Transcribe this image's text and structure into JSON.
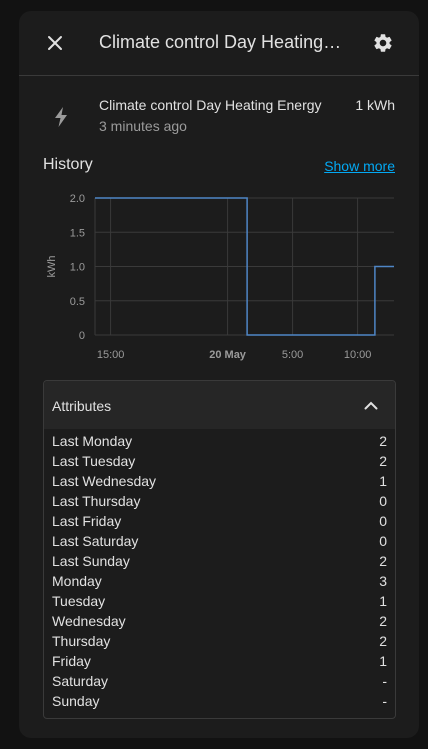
{
  "dialog": {
    "title": "Climate control Day Heating Energy",
    "close_icon": "close-icon",
    "settings_icon": "gear-icon"
  },
  "entity": {
    "icon": "flash-icon",
    "name": "Climate control Day Heating Energy",
    "time": "3 minutes ago",
    "state": "1 kWh"
  },
  "history": {
    "title": "History",
    "show_more": "Show more"
  },
  "chart_data": {
    "type": "line",
    "step": true,
    "ylabel": "kWh",
    "ylim": [
      0,
      2.0
    ],
    "yticks": [
      "2.0",
      "1.5",
      "1.0",
      "0.5",
      "0"
    ],
    "xticks": [
      "15:00",
      "20 May",
      "5:00",
      "10:00"
    ],
    "x_range_hours": [
      13.8,
      12.8
    ],
    "series": [
      {
        "color": "#4f86c6",
        "points": [
          {
            "x": "19 May 13:48",
            "y": 2
          },
          {
            "x": "20 May 01:30",
            "y": 2
          },
          {
            "x": "20 May 01:30",
            "y": 0
          },
          {
            "x": "20 May 11:20",
            "y": 0
          },
          {
            "x": "20 May 11:20",
            "y": 1
          },
          {
            "x": "20 May 12:48",
            "y": 1
          }
        ]
      }
    ],
    "grid": true
  },
  "attributes": {
    "title": "Attributes",
    "chevron_icon": "chevron-up-icon",
    "rows": [
      {
        "key": "Last Monday",
        "value": "2"
      },
      {
        "key": "Last Tuesday",
        "value": "2"
      },
      {
        "key": "Last Wednesday",
        "value": "1"
      },
      {
        "key": "Last Thursday",
        "value": "0"
      },
      {
        "key": "Last Friday",
        "value": "0"
      },
      {
        "key": "Last Saturday",
        "value": "0"
      },
      {
        "key": "Last Sunday",
        "value": "2"
      },
      {
        "key": "Monday",
        "value": "3"
      },
      {
        "key": "Tuesday",
        "value": "1"
      },
      {
        "key": "Wednesday",
        "value": "2"
      },
      {
        "key": "Thursday",
        "value": "2"
      },
      {
        "key": "Friday",
        "value": "1"
      },
      {
        "key": "Saturday",
        "value": "-"
      },
      {
        "key": "Sunday",
        "value": "-"
      }
    ]
  }
}
